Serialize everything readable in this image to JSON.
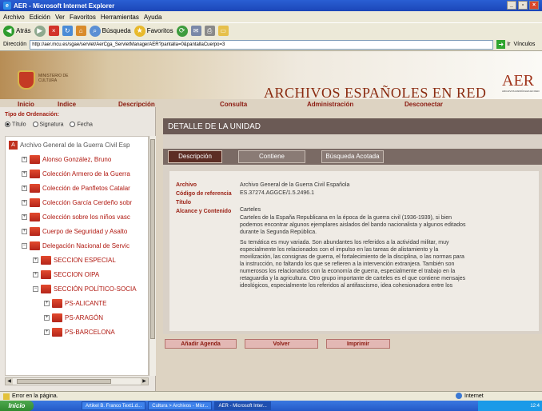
{
  "window": {
    "title": "AER - Microsoft Internet Explorer",
    "controls": [
      "_",
      "▫",
      "×"
    ]
  },
  "menu": [
    "Archivo",
    "Edición",
    "Ver",
    "Favoritos",
    "Herramientas",
    "Ayuda"
  ],
  "toolbar": {
    "back_label": "Atrás",
    "search_label": "Búsqueda",
    "favorites_label": "Favoritos"
  },
  "address": {
    "label": "Dirección",
    "url": "http://aer.mcu.es/sgae/servlet/AerCga_ServletManagerAER?pantalla=0&pantallaCuerpo=3",
    "go_label": "Ir",
    "links_label": "Vínculos"
  },
  "header": {
    "ministry": "MINISTERIO DE CULTURA",
    "site_title": "ARCHIVOS ESPAÑOLES EN RED",
    "logo_text": "AER",
    "logo_subtitle": "ARCHIVOS ESPAÑOLES EN RED"
  },
  "nav": {
    "inicio": "Inicio",
    "indice": "Indice",
    "descripcion": "Descripción",
    "consulta": "Consulta",
    "administracion": "Administración",
    "desconectar": "Desconectar"
  },
  "sidebar": {
    "order_label": "Tipo de Ordenación:",
    "order_options": [
      "Título",
      "Signatura",
      "Fecha"
    ],
    "tree": [
      "Archivo General de la Guerra Civil Esp",
      "Alonso González, Bruno",
      "Colección Armero de la Guerra",
      "Colección de Panfletos Catalar",
      "Colección García Cerdeño sobr",
      "Colección sobre los niños vasc",
      "Cuerpo de Seguridad y Asalto",
      "Delegación Nacional de Servic",
      "SECCION ESPECIAL",
      "SECCION OIPA",
      "SECCIÓN POLÍTICO-SOCIA",
      "PS-ALICANTE",
      "PS-ARAGÓN",
      "PS-BARCELONA"
    ]
  },
  "detail": {
    "heading": "DETALLE DE LA UNIDAD",
    "tabs": [
      "Descripción",
      "Contiene",
      "Búsqueda Acotada"
    ],
    "labels": {
      "archivo": "Archivo",
      "codigo": "Código de referencia",
      "titulo": "Título",
      "alcance": "Alcance y Contenido"
    },
    "values": {
      "archivo": "Archivo General de la Guerra Civil Española",
      "codigo": "ES.37274.AGGCE/1.5.2496.1",
      "titulo": "Carteles",
      "alcance_p1": "Carteles de la España Republicana en la época de la guerra civil (1936-1939), si bien podemos encontrar algunos ejemplares aislados del bando nacionalista y algunos editados durante la Segunda República.",
      "alcance_p2": "Su temática es muy variada. Son abundantes los referidos a la actividad militar, muy especialmente los relacionados con el impulso en las tareas de alistamiento y la movilización, las consignas de guerra, el fortalecimiento de la disciplina, o las normas para la instrucción, no faltando los que se refieren a la intervención extranjera. También son numerosos los relacionados con la economía de guerra, especialmente el trabajo en la retaguardia y la agricultura. Otro grupo importante de carteles es el que contiene mensajes ideológicos, especialmente los referidos al antifascismo, idea cohesionadora entre los"
    },
    "actions": [
      "Añadir Agenda",
      "Volver",
      "Imprimir"
    ]
  },
  "status": {
    "message": "Error en la página.",
    "zone": "Internet"
  },
  "taskbar": {
    "start": "Inicio",
    "tasks": [
      "Artikel B. Franco Text1.d...",
      "Cultura > Archivos - Micr...",
      "AER - Microsoft Inter..."
    ],
    "clock": "12:4"
  }
}
